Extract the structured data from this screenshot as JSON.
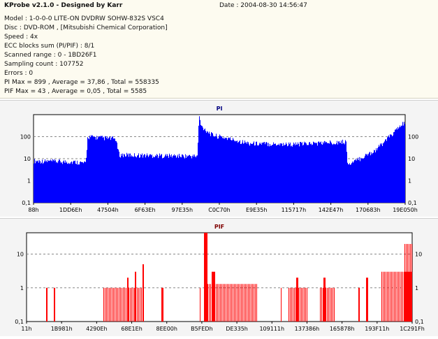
{
  "header": {
    "title": "KProbe v2.1.0 - Designed by Karr",
    "date": "Date : 2004-08-30 14:56:47",
    "lines": [
      "Model : 1-0-0-0 LITE-ON DVDRW SOHW-832S  VSC4",
      "Disc : DVD-ROM ,  [Mitsubishi Chemical Corporation]",
      "Speed : 4x",
      "ECC blocks sum (PI/PIF) : 8/1",
      "Scanned range : 0 - 1BD26F1",
      "Sampling count : 107752",
      "Errors : 0",
      "PI Max = 899 , Average = 37,86 , Total = 558335",
      "PIF Max = 43 , Average = 0,05 , Total = 5585"
    ]
  },
  "colors": {
    "bars": "#0000ff",
    "pif_bars": "#ff0000",
    "title_pi": "#000080",
    "title_pif": "#800000"
  },
  "chart_data": [
    {
      "type": "bar",
      "title": "PI",
      "scale": "log",
      "ylim": [
        0.1,
        1000
      ],
      "ytick_labels": [
        "100",
        "10",
        "1",
        "0,1"
      ],
      "ytick_values": [
        100,
        10,
        1,
        0.1
      ],
      "xtick_labels": [
        "88h",
        "1DD6Eh",
        "47504h",
        "6F63Eh",
        "97E35h",
        "C0C70h",
        "E9E35h",
        "115717h",
        "142E47h",
        "170683h",
        "19E050h"
      ],
      "profile": [
        [
          0.0,
          8
        ],
        [
          0.12,
          7
        ],
        [
          0.14,
          6
        ],
        [
          0.145,
          100
        ],
        [
          0.22,
          80
        ],
        [
          0.23,
          15
        ],
        [
          0.44,
          13
        ],
        [
          0.445,
          900
        ],
        [
          0.45,
          300
        ],
        [
          0.48,
          120
        ],
        [
          0.58,
          50
        ],
        [
          0.7,
          45
        ],
        [
          0.84,
          60
        ],
        [
          0.845,
          5
        ],
        [
          0.86,
          7
        ],
        [
          0.92,
          25
        ],
        [
          1.0,
          500
        ]
      ]
    },
    {
      "type": "bar",
      "title": "PIF",
      "scale": "log",
      "ylim": [
        0.1,
        43
      ],
      "ytick_labels": [
        "10",
        "1",
        "0,1"
      ],
      "ytick_values": [
        10,
        1,
        0.1
      ],
      "xtick_labels": [
        "11h",
        "1B981h",
        "4290Eh",
        "68E1Eh",
        "8EE00h",
        "B5FEDh",
        "DE335h",
        "109111h",
        "137386h",
        "165878h",
        "193F11h",
        "1C291Fh"
      ],
      "clusters": [
        [
          0.05,
          0.055,
          1
        ],
        [
          0.07,
          0.075,
          1
        ],
        [
          0.2,
          0.3,
          1
        ],
        [
          0.26,
          0.265,
          2
        ],
        [
          0.28,
          0.285,
          3
        ],
        [
          0.35,
          0.355,
          1
        ],
        [
          0.3,
          0.305,
          5
        ],
        [
          0.45,
          0.45,
          1
        ],
        [
          0.46,
          0.47,
          43
        ],
        [
          0.47,
          0.6,
          1.3
        ],
        [
          0.48,
          0.49,
          3
        ],
        [
          0.66,
          0.66,
          1
        ],
        [
          0.68,
          0.73,
          1
        ],
        [
          0.7,
          0.705,
          2
        ],
        [
          0.76,
          0.8,
          1
        ],
        [
          0.77,
          0.775,
          2
        ],
        [
          0.86,
          0.865,
          1
        ],
        [
          0.88,
          0.885,
          2
        ],
        [
          0.92,
          1.0,
          3
        ],
        [
          0.98,
          1.0,
          20
        ]
      ]
    }
  ]
}
